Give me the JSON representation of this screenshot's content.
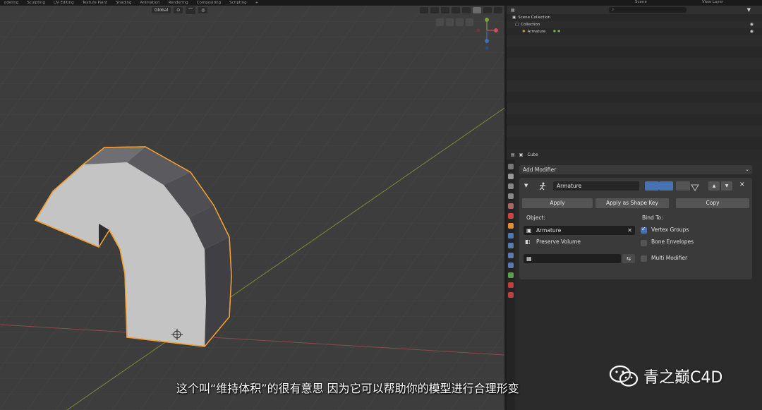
{
  "topbar": {
    "workspaces": [
      "odeling",
      "Sculpting",
      "UV Editing",
      "Texture Paint",
      "Shading",
      "Animation",
      "Rendering",
      "Compositing",
      "Scripting",
      "+"
    ],
    "scene": "Scene",
    "view_layer": "View Layer"
  },
  "viewport": {
    "transform_orientation": "Global"
  },
  "outliner": {
    "rows": [
      {
        "label": "Scene Collection"
      },
      {
        "label": "Collection"
      },
      {
        "label": "Armature"
      }
    ]
  },
  "properties": {
    "object_name": "Cube",
    "add_modifier_label": "Add Modifier",
    "modifier": {
      "name": "Armature",
      "apply_label": "Apply",
      "apply_shape_key_label": "Apply as Shape Key",
      "copy_label": "Copy",
      "object_label": "Object:",
      "object_value": "Armature",
      "preserve_volume_label": "Preserve Volume",
      "bind_to_label": "Bind To:",
      "vertex_groups_label": "Vertex Groups",
      "vertex_groups_checked": true,
      "bone_envelopes_label": "Bone Envelopes",
      "bone_envelopes_checked": false,
      "multi_modifier_label": "Multi Modifier",
      "multi_modifier_checked": false
    }
  },
  "subtitle": "这个叫“维持体积”的很有意思 因为它可以帮助你的模型进行合理形变",
  "watermark": "青之巅C4D",
  "colors": {
    "viewport_bg": "#3d3d3d",
    "mesh_face": "#bdbdbd",
    "mesh_outline": "#f0a030",
    "accent_blue": "#4772b3"
  }
}
